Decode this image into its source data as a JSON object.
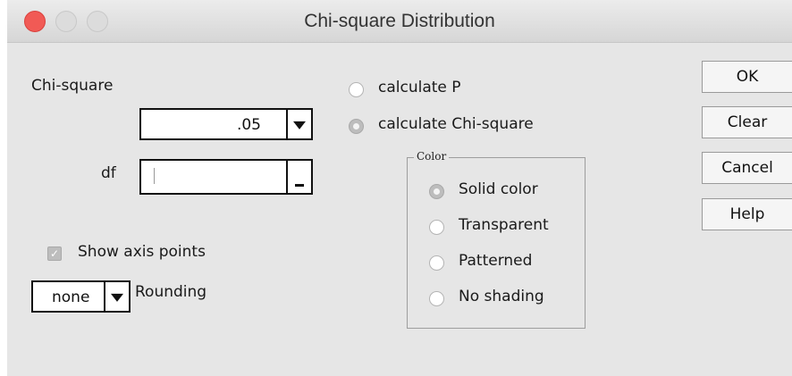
{
  "window": {
    "title": "Chi-square Distribution"
  },
  "chi_square": {
    "label": "Chi-square",
    "value": ".05"
  },
  "df": {
    "label": "df",
    "value": ""
  },
  "show_axis_points": {
    "label": "Show axis points",
    "checked": true
  },
  "rounding": {
    "value": "none",
    "label": "Rounding"
  },
  "calc_mode": {
    "options": [
      {
        "label": "calculate P",
        "selected": false
      },
      {
        "label": "calculate Chi-square",
        "selected": true
      }
    ]
  },
  "color_group": {
    "title": "Color",
    "options": [
      {
        "label": "Solid color",
        "selected": true
      },
      {
        "label": "Transparent",
        "selected": false
      },
      {
        "label": "Patterned",
        "selected": false
      },
      {
        "label": "No shading",
        "selected": false
      }
    ]
  },
  "buttons": {
    "ok": "OK",
    "clear": "Clear",
    "cancel": "Cancel",
    "help": "Help"
  }
}
